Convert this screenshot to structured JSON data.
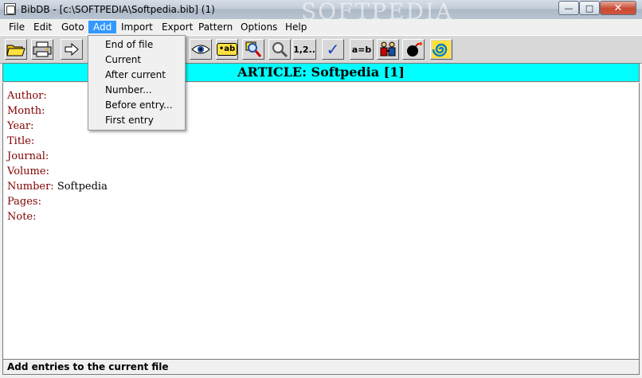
{
  "window": {
    "title": "BibDB - [c:\\SOFTPEDIA\\Softpedia.bib] (1)",
    "watermark": "SOFTPEDIA",
    "controls": {
      "minimize": "—",
      "maximize": "□",
      "close": "✕"
    }
  },
  "menubar": {
    "items": [
      "File",
      "Edit",
      "Goto",
      "Add",
      "Import",
      "Export",
      "Pattern",
      "Options",
      "Help"
    ],
    "active": "Add"
  },
  "add_menu": {
    "items": [
      "End of file",
      "Current",
      "After current",
      "Number...",
      "Before entry...",
      "First entry"
    ]
  },
  "toolbar": {
    "buttons": [
      {
        "icon": "open-folder-icon"
      },
      {
        "icon": "print-icon"
      },
      {
        "icon": "arrow-right-icon"
      },
      {
        "icon": "eye-icon"
      },
      {
        "icon": "label-icon",
        "text": "•ab"
      },
      {
        "icon": "magnifier-icon"
      },
      {
        "icon": "magnifier-gray-icon"
      },
      {
        "icon": "numbering-icon",
        "text": "1,2.."
      },
      {
        "icon": "checkmark-icon",
        "text": "✓"
      },
      {
        "icon": "equals-icon",
        "text": "a=b"
      },
      {
        "icon": "people-icon"
      },
      {
        "icon": "bomb-icon"
      },
      {
        "icon": "spiral-icon"
      }
    ]
  },
  "record": {
    "header": "ARTICLE: Softpedia  [1]",
    "fields": [
      {
        "label": "Author:",
        "value": ""
      },
      {
        "label": "Month:",
        "value": ""
      },
      {
        "label": "Year:",
        "value": ""
      },
      {
        "label": "Title:",
        "value": ""
      },
      {
        "label": "Journal:",
        "value": ""
      },
      {
        "label": "Volume:",
        "value": ""
      },
      {
        "label": "Number:",
        "value": "Softpedia"
      },
      {
        "label": "Pages:",
        "value": ""
      },
      {
        "label": "Note:",
        "value": ""
      }
    ]
  },
  "status": {
    "text": "Add entries to the current file"
  },
  "colors": {
    "header_band": "#00ffff",
    "field_label": "#800000",
    "menu_highlight": "#3399ff"
  }
}
